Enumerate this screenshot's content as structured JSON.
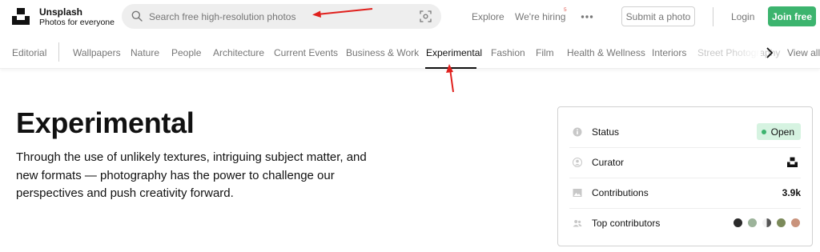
{
  "header": {
    "brand_name": "Unsplash",
    "brand_tagline": "Photos for everyone",
    "search_placeholder": "Search free high-resolution photos",
    "nav": {
      "explore": "Explore",
      "hiring": "We're hiring",
      "hiring_badge": "5"
    },
    "submit_label": "Submit a photo",
    "login_label": "Login",
    "join_label": "Join free"
  },
  "topics": {
    "editorial": "Editorial",
    "items": [
      "Wallpapers",
      "Nature",
      "People",
      "Architecture",
      "Current Events",
      "Business & Work",
      "Experimental",
      "Fashion",
      "Film",
      "Health & Wellness",
      "Interiors",
      "Street Photography"
    ],
    "active": "Experimental",
    "view_all": "View all"
  },
  "main": {
    "title": "Experimental",
    "description": "Through the use of unlikely textures, intriguing subject matter, and new formats — photography has the power to challenge our perspectives and push creativity forward."
  },
  "info_card": {
    "status_label": "Status",
    "status_value": "Open",
    "curator_label": "Curator",
    "contributions_label": "Contributions",
    "contributions_value": "3.9k",
    "top_contributors_label": "Top contributors",
    "contributor_count": 5
  },
  "colors": {
    "accent_green": "#3cb46e",
    "status_bg": "#d6f3e1",
    "annotation_red": "#e0201d",
    "hiring_badge": "#e25950"
  },
  "icons": [
    "unsplash-logo",
    "search-icon",
    "visual-search-icon",
    "more-icon",
    "chevron-right-icon",
    "info-icon",
    "user-icon",
    "image-icon",
    "users-icon",
    "curator-logo"
  ]
}
